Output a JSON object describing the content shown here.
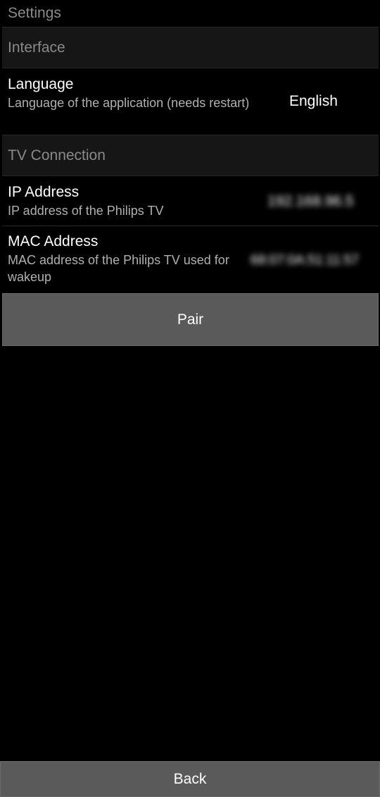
{
  "page": {
    "title": "Settings"
  },
  "sections": {
    "interface": {
      "header": "Interface"
    },
    "tv_connection": {
      "header": "TV Connection"
    }
  },
  "language": {
    "label": "Language",
    "description": "Language of the application (needs restart)",
    "value": "English"
  },
  "ip_address": {
    "label": "IP Address",
    "description": "IP address of the Philips TV",
    "value": "192.168.96.5"
  },
  "mac_address": {
    "label": "MAC Address",
    "description": "MAC address of the Philips TV used for wakeup",
    "value": "68:07:0A:51:11:57"
  },
  "buttons": {
    "pair": "Pair",
    "back": "Back"
  }
}
